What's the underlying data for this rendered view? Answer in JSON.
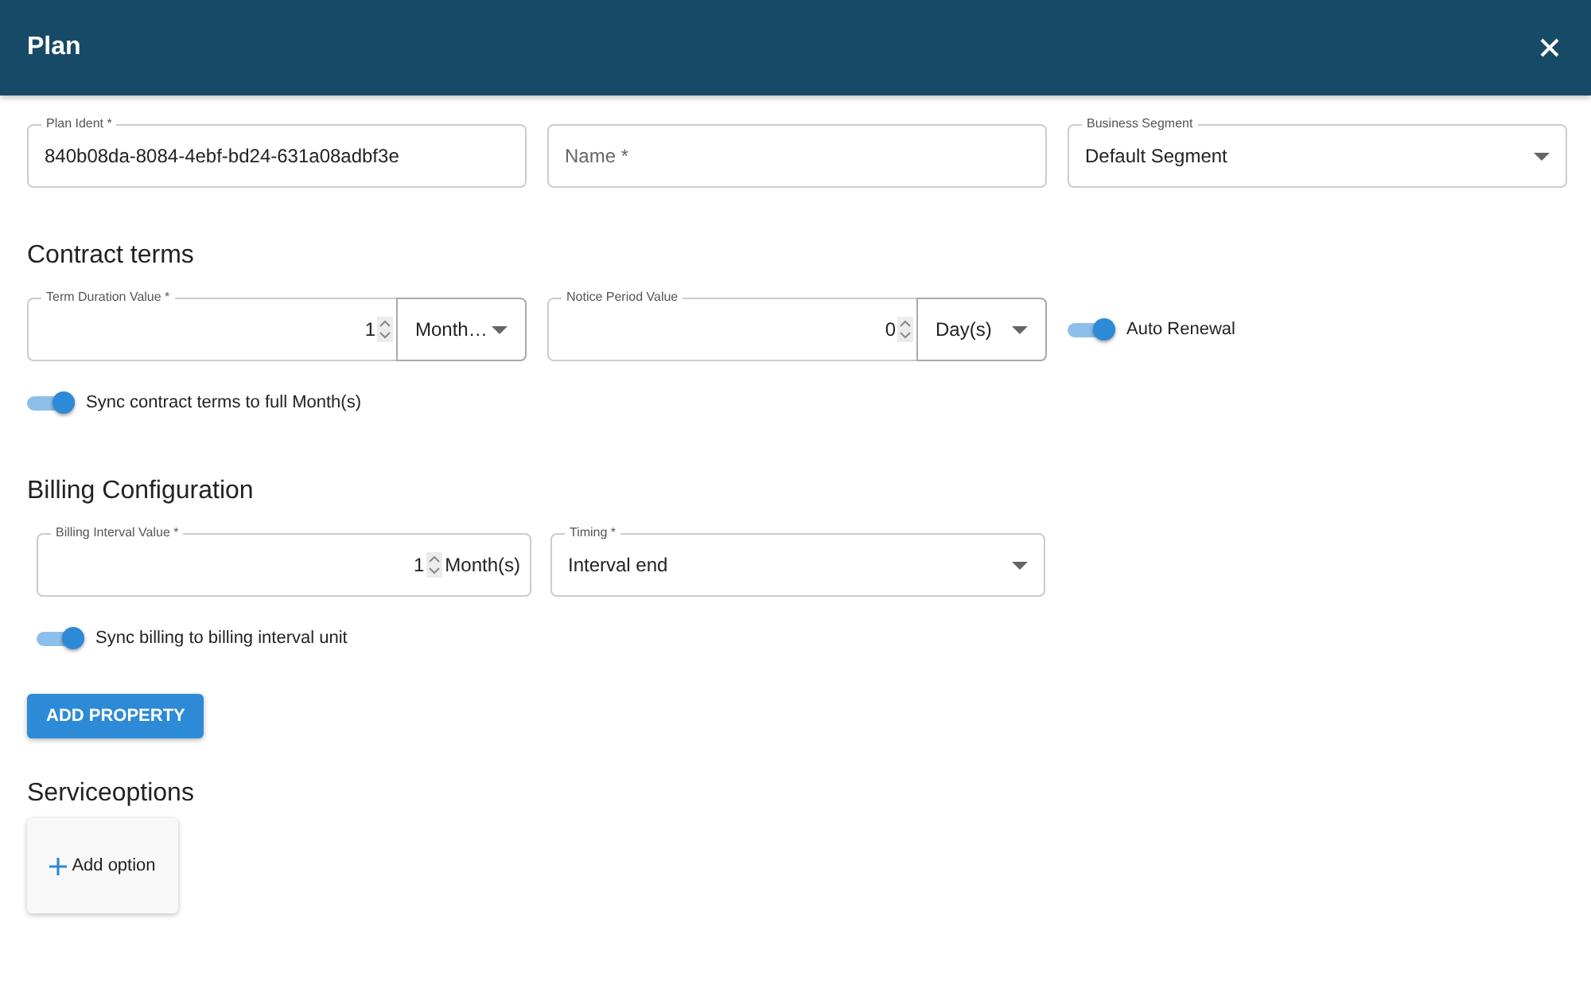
{
  "header": {
    "title": "Plan"
  },
  "top_fields": [
    {
      "kind": "text",
      "label": "Plan Ident *",
      "value": "840b08da-8084-4ebf-bd24-631a08adbf3e"
    },
    {
      "kind": "text",
      "placeholder": "Name *"
    },
    {
      "kind": "select",
      "label": "Business Segment",
      "value": "Default Segment"
    }
  ],
  "contract_terms": {
    "heading": "Contract terms",
    "items": [
      {
        "kind": "number-unit",
        "label": "Term Duration Value *",
        "value": "1",
        "unit": "Month…"
      },
      {
        "kind": "number-unit",
        "label": "Notice Period Value",
        "value": "0",
        "unit": "Day(s)"
      },
      {
        "kind": "toggle",
        "label": "Auto Renewal",
        "on": true
      }
    ],
    "toggles": [
      {
        "label": "Sync contract terms to full Month(s)",
        "on": true
      }
    ]
  },
  "billing": {
    "heading": "Billing Configuration",
    "items": [
      {
        "kind": "number-suffix",
        "label": "Billing Interval Value *",
        "value": "1",
        "suffix": "Month(s)"
      },
      {
        "kind": "select",
        "label": "Timing *",
        "value": "Interval end"
      }
    ],
    "toggles": [
      {
        "label": "Sync billing to billing interval unit",
        "on": true
      }
    ]
  },
  "add_property_button": "ADD PROPERTY",
  "service_options": {
    "heading": "Serviceoptions",
    "add_label": "Add option"
  }
}
